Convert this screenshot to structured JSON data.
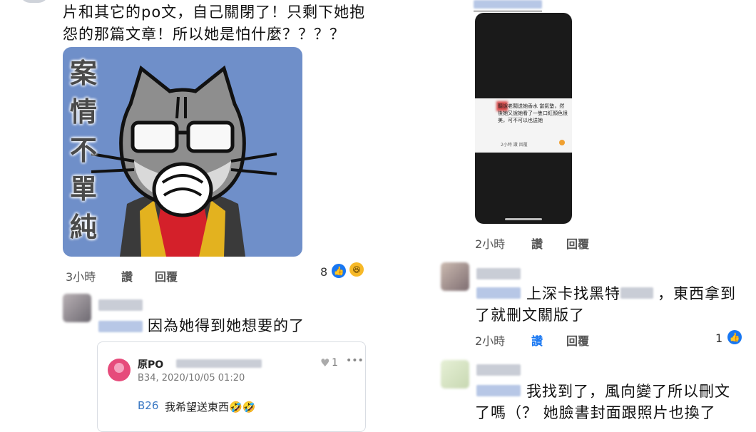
{
  "left": {
    "comment1": {
      "line1": "片和其它的po文，自己關閉了！只剩下她抱",
      "line2": "怨的那篇文章！所以她是怕什麼？？？？",
      "sticker_text": "案情不單純",
      "time": "3小時",
      "like": "讚",
      "reply": "回覆",
      "reaction_count": "8"
    },
    "comment2": {
      "text": "因為她得到她想要的了"
    },
    "quote": {
      "author": "原PO",
      "meta": "B34, 2020/10/05 01:20",
      "like_count": "1",
      "floor": "B26",
      "text": "我希望送東西🤣🤣"
    }
  },
  "right": {
    "post": {
      "screenshot_text": "聽說老闆送她香水 當氣墊，然後她又說她看了一隻口紅顏色很美，可不可以也送她",
      "screenshot_meta": "2小時 讚 回覆",
      "time": "2小時",
      "like": "讚",
      "reply": "回覆"
    },
    "comment3": {
      "line1": "上深卡找黑特",
      "line1b": "，東西拿到",
      "line2": "了就刪文關版了",
      "time": "2小時",
      "like": "讚",
      "reply": "回覆",
      "reaction_count": "1"
    },
    "comment4": {
      "line1": "我找到了，風向變了所以刪文",
      "line2": "了嗎（？ 她臉書封面跟照片也換了"
    }
  },
  "colors": {
    "like_blue": "#1877f2",
    "sticker_bg": "#6f8fc9",
    "dark_card": "#1a1a1a"
  }
}
